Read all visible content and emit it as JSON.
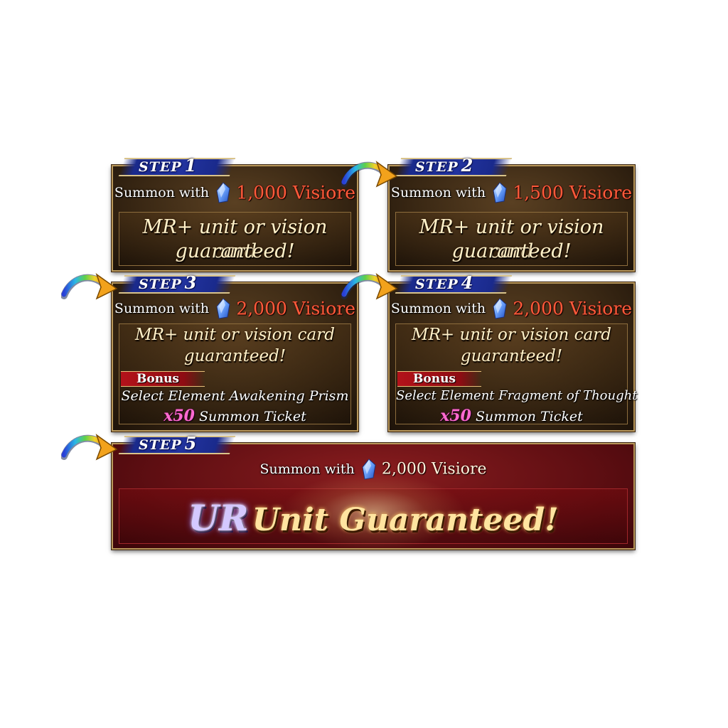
{
  "steps": [
    {
      "label": "STEP",
      "number": "1",
      "summon_label": "Summon with",
      "amount": "1,000 Visiore",
      "guarantee_line1": "MR+ unit or vision card",
      "guarantee_line2": "guaranteed!"
    },
    {
      "label": "STEP",
      "number": "2",
      "summon_label": "Summon with",
      "amount": "1,500 Visiore",
      "guarantee_line1": "MR+ unit or vision card",
      "guarantee_line2": "guaranteed!"
    },
    {
      "label": "STEP",
      "number": "3",
      "summon_label": "Summon with",
      "amount": "2,000 Visiore",
      "guarantee_line1": "MR+ unit or vision card",
      "guarantee_line2": "guaranteed!",
      "bonus_label": "Bonus",
      "bonus_item": "Select Element Awakening Prism",
      "bonus_qty": "x50",
      "bonus_extra": "Summon Ticket"
    },
    {
      "label": "STEP",
      "number": "4",
      "summon_label": "Summon with",
      "amount": "2,000 Visiore",
      "guarantee_line1": "MR+ unit or vision card",
      "guarantee_line2": "guaranteed!",
      "bonus_label": "Bonus",
      "bonus_item": "Select Element Fragment of Thought",
      "bonus_qty": "x50",
      "bonus_extra": "Summon Ticket"
    },
    {
      "label": "STEP",
      "number": "5",
      "summon_label": "Summon with",
      "amount": "2,000 Visiore",
      "ur_text": "UR",
      "ur_rest": "Unit Guaranteed!"
    }
  ],
  "icons": {
    "currency": "visiore-crystal-icon",
    "arrow": "rainbow-arrow-icon"
  },
  "colors": {
    "step_banner": "#22339f",
    "panel_brown": "#3a2814",
    "panel_red": "#5e0e12",
    "amount_red": "#ff5a3a",
    "bonus_pink": "#ff6ad0",
    "frame_gold": "#b8975a"
  }
}
